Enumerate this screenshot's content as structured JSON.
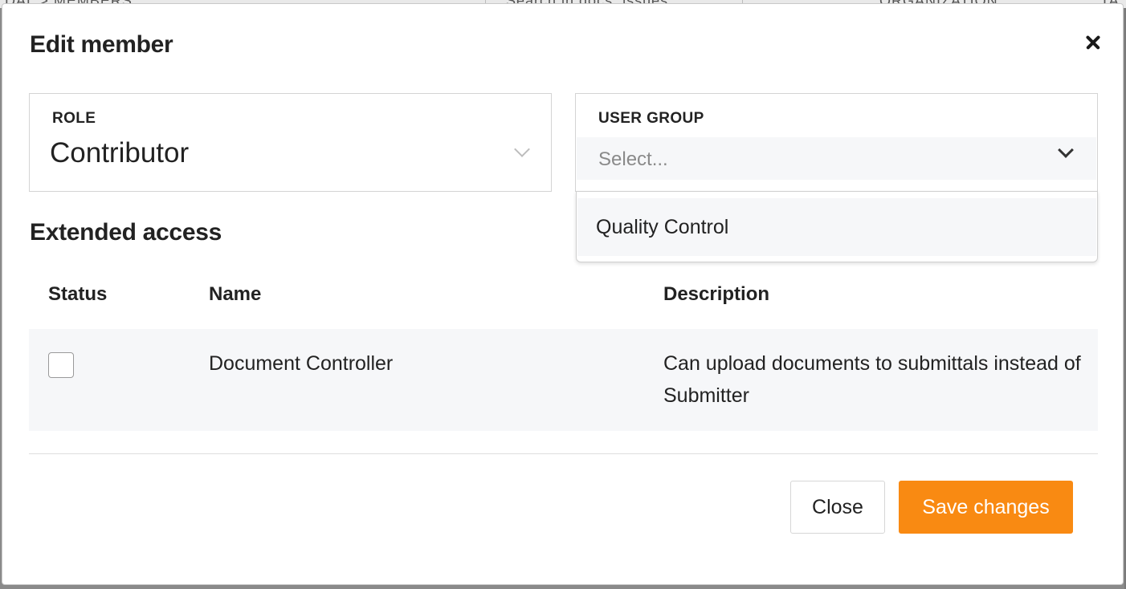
{
  "background": {
    "breadcrumb": "DAL  >  MEMBERS",
    "search_text": "Search in docs, issues",
    "org_label": "ORGANIZATION",
    "tab_label": "TA"
  },
  "modal": {
    "title": "Edit member",
    "close_icon": "close-icon",
    "role": {
      "label": "ROLE",
      "value": "Contributor",
      "icon": "chevron-down-icon"
    },
    "user_group": {
      "label": "USER GROUP",
      "placeholder": "Select...",
      "icon": "chevron-down-icon",
      "options": [
        "Quality Control"
      ]
    },
    "extended_access": {
      "title": "Extended access",
      "columns": [
        "Status",
        "Name",
        "Description"
      ],
      "rows": [
        {
          "checked": false,
          "name": "Document Controller",
          "description": "Can upload documents to submittals instead of Submitter"
        }
      ]
    },
    "footer": {
      "close_label": "Close",
      "save_label": "Save changes",
      "save_color": "#f98a12"
    }
  }
}
